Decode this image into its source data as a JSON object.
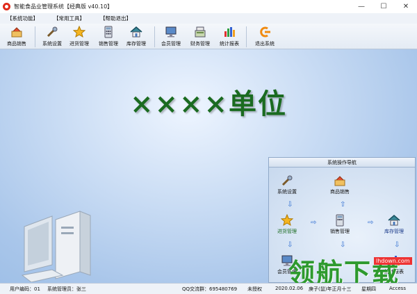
{
  "window": {
    "title": "智能食品业管理系统【经典版 v40.10】",
    "controls": {
      "minimize": "—",
      "maximize": "☐",
      "close": "✕"
    }
  },
  "menu": [
    {
      "label": "【系统功能】"
    },
    {
      "label": "【常用工具】"
    },
    {
      "label": "【帮助退出】"
    }
  ],
  "toolbar": [
    {
      "label": "商品销售",
      "icon": "product-sales-icon"
    },
    {
      "label": "系统设置",
      "icon": "system-settings-icon"
    },
    {
      "label": "进货管理",
      "icon": "purchase-icon"
    },
    {
      "label": "销售管理",
      "icon": "calculator-icon"
    },
    {
      "label": "库存管理",
      "icon": "house-icon"
    },
    {
      "label": "会员管理",
      "icon": "monitor-icon"
    },
    {
      "label": "财务管理",
      "icon": "cash-register-icon"
    },
    {
      "label": "统计报表",
      "icon": "bar-chart-icon"
    },
    {
      "label": "退出系统",
      "icon": "exit-icon"
    }
  ],
  "main": {
    "unit_title": "××××单位"
  },
  "nav_panel": {
    "title": "系统操作导航",
    "nodes": [
      {
        "label": "系统设置",
        "icon": "system-settings-icon"
      },
      {
        "label": "商品销售",
        "icon": "product-sales-icon"
      },
      {
        "label": "进货管理",
        "icon": "purchase-icon"
      },
      {
        "label": "销售管理",
        "icon": "calculator-icon"
      },
      {
        "label": "库存管理",
        "icon": "house-icon"
      },
      {
        "label": "会员管理",
        "icon": "monitor-icon"
      },
      {
        "label": "统计报表",
        "icon": "bar-chart-icon"
      }
    ]
  },
  "status": {
    "user_code": "用户编码：01",
    "admin": "系统管理员：张三",
    "qq": "QQ交流群：695480769",
    "license": "未授权",
    "date": "2020.02.06",
    "lunar": "庚子(鼠)年正月十三",
    "weekday": "星期四",
    "db": "Access"
  },
  "watermark": {
    "text": "领航下载",
    "url": "lhdown.com"
  },
  "colors": {
    "accent_green": "#1a6b20",
    "watermark_green": "#2e9a2e",
    "background_blue": "#a9c6ea"
  }
}
